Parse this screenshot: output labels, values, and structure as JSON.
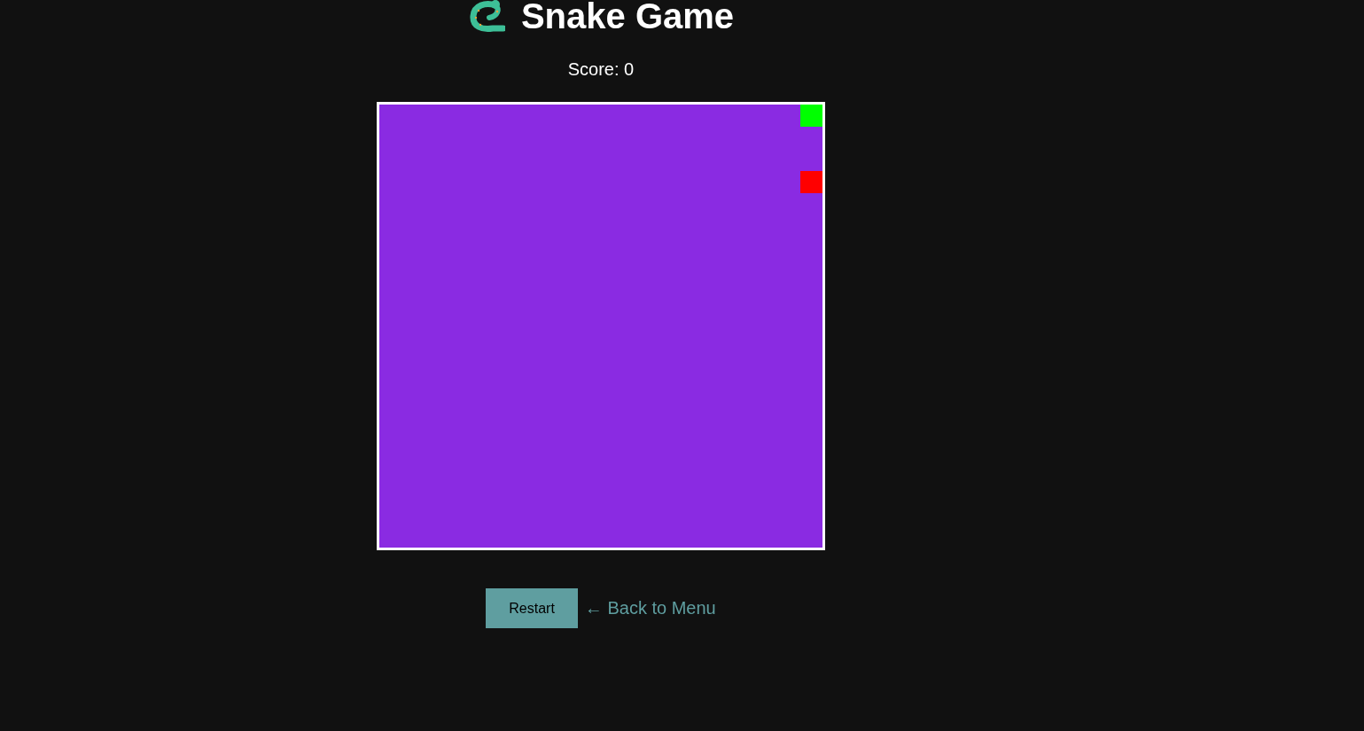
{
  "header": {
    "title": "Snake Game"
  },
  "score": "Score: 0",
  "board": {
    "pieces": [
      {
        "kind": "snake",
        "color": "#00ff00"
      },
      {
        "kind": "food",
        "color": "#ff0000"
      }
    ]
  },
  "actions": {
    "restart": "Restart",
    "back_link": "← Back to Menu"
  }
}
